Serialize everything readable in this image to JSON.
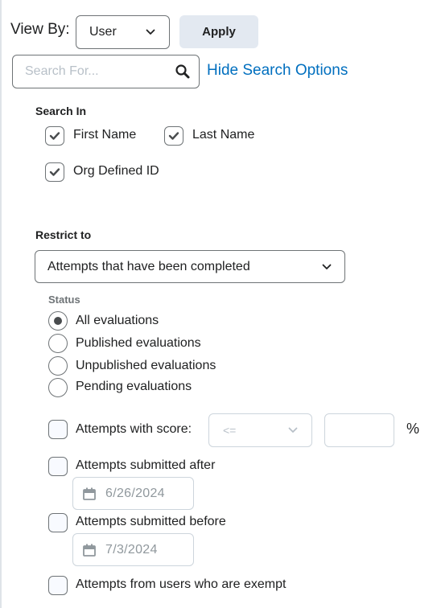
{
  "view_by": {
    "label": "View By:",
    "selected": "User",
    "apply_label": "Apply"
  },
  "search": {
    "placeholder": "Search For...",
    "value": "",
    "icon": "search-icon",
    "hide_options_label": "Hide Search Options"
  },
  "search_in": {
    "label": "Search In",
    "options": [
      {
        "label": "First Name",
        "checked": true
      },
      {
        "label": "Last Name",
        "checked": true
      },
      {
        "label": "Org Defined ID",
        "checked": true
      }
    ]
  },
  "restrict_to": {
    "label": "Restrict to",
    "selected": "Attempts that have been completed",
    "status": {
      "label": "Status",
      "options": [
        {
          "label": "All evaluations",
          "selected": true
        },
        {
          "label": "Published evaluations",
          "selected": false
        },
        {
          "label": "Unpublished evaluations",
          "selected": false
        },
        {
          "label": "Pending evaluations",
          "selected": false
        }
      ]
    },
    "score_filter": {
      "label": "Attempts with score:",
      "checked": false,
      "operator": "<=",
      "value": "",
      "unit": "%"
    },
    "submitted_after": {
      "label": "Attempts submitted after",
      "checked": false,
      "date": "6/26/2024"
    },
    "submitted_before": {
      "label": "Attempts submitted before",
      "checked": false,
      "date": "7/3/2024"
    },
    "exempt": {
      "label": "Attempts from users who are exempt",
      "checked": false
    }
  },
  "colors": {
    "link": "#006fbf",
    "button_bg": "#e3e9f1",
    "border": "#6e7376",
    "disabled_border": "#cdd5dc",
    "placeholder": "#b8c0c8"
  }
}
